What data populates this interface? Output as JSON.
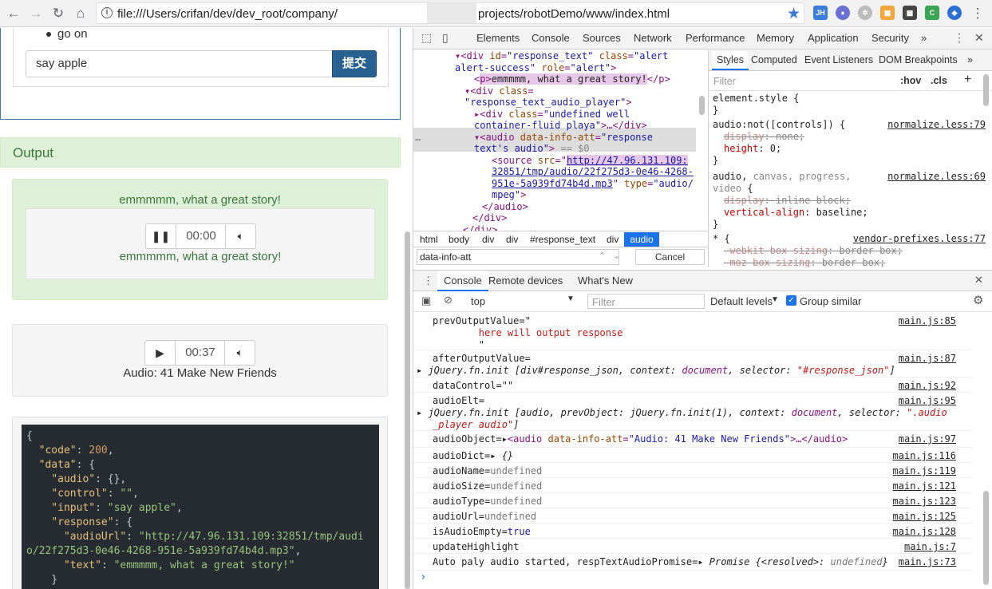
{
  "browser": {
    "url_part1": "file:///Users/crifan/dev/dev_root/company/",
    "url_part2": "projects/robotDemo/www/index.html"
  },
  "page": {
    "bullet": "go on",
    "input_value": "say apple",
    "submit_label": "提交",
    "output_heading": "Output",
    "alert_text": "emmmmm, what a great story!",
    "player1_time": "00:00",
    "player1_caption": "emmmmm, what a great story!",
    "player2_time": "00:37",
    "player2_caption": "Audio: 41 Make New Friends"
  },
  "devtools": {
    "tabs": [
      "Elements",
      "Console",
      "Sources",
      "Network",
      "Performance",
      "Memory",
      "Application",
      "Security"
    ],
    "more": "»",
    "breadcrumbs": [
      "html",
      "body",
      "div",
      "div",
      "#response_text",
      "div",
      "audio"
    ],
    "search_value": "data-info-att",
    "cancel_label": "Cancel",
    "styles_tabs": [
      "Styles",
      "Computed",
      "Event Listeners",
      "DOM Breakpoints"
    ],
    "filter_placeholder": "Filter",
    "hov": ":hov",
    "cls": ".cls",
    "drawer_tabs": [
      "Console",
      "Remote devices",
      "What's New"
    ],
    "context": "top",
    "console_filter_placeholder": "Filter",
    "levels": "Default levels",
    "group_similar": "Group similar"
  },
  "console_messages": [
    {
      "src": "main.js:85"
    },
    {
      "src": "main.js:87"
    },
    {
      "src": "main.js:92"
    },
    {
      "src": "main.js:95"
    },
    {
      "src": "main.js:97"
    },
    {
      "src": "main.js:116"
    },
    {
      "src": "main.js:119"
    },
    {
      "src": "main.js:121"
    },
    {
      "src": "main.js:123"
    },
    {
      "src": "main.js:125"
    },
    {
      "src": "main.js:128"
    },
    {
      "src": "main.js:7"
    },
    {
      "src": "main.js:73"
    }
  ],
  "styles_sources": [
    "normalize.less:79",
    "normalize.less:69",
    "vendor-prefixes.less:77"
  ]
}
